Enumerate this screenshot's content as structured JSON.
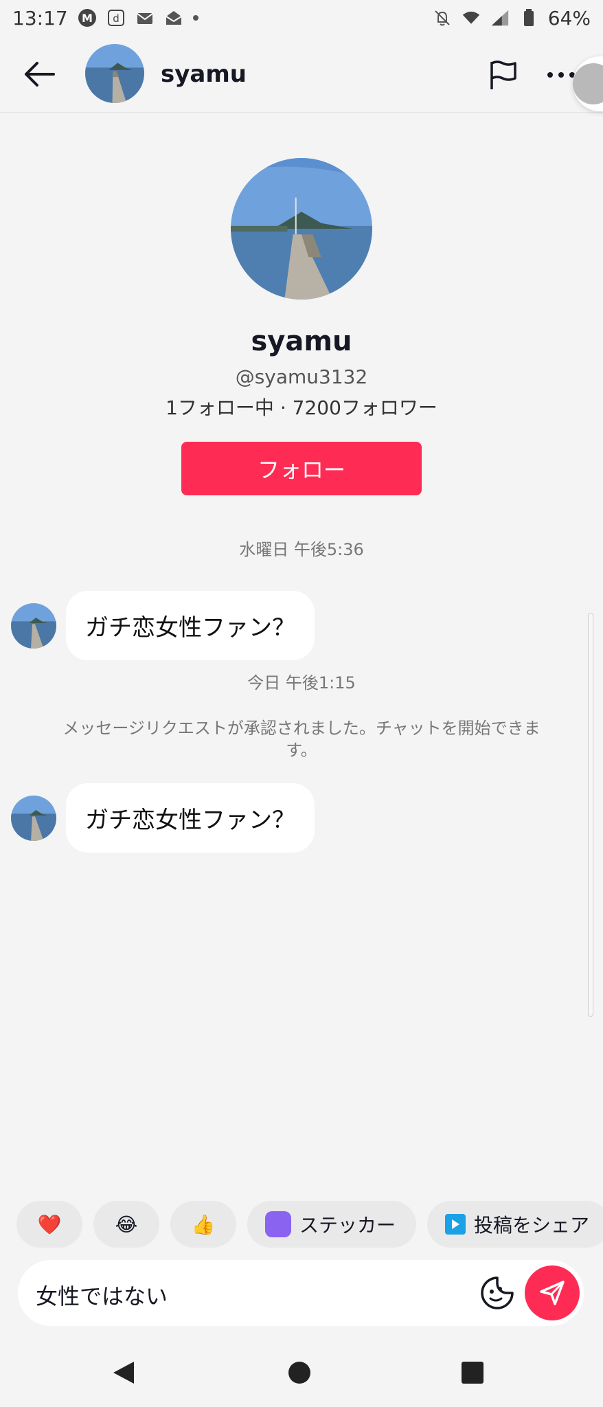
{
  "status_bar": {
    "time": "13:17",
    "battery": "64%"
  },
  "header": {
    "name": "syamu"
  },
  "profile": {
    "name": "syamu",
    "handle": "@syamu3132",
    "stats": "1フォロー中 · 7200フォロワー",
    "follow_label": "フォロー"
  },
  "chat": {
    "timestamp_1": "水曜日 午後5:36",
    "message_1": "ガチ恋女性ファン？",
    "timestamp_2": "今日 午後1:15",
    "system_notice": "メッセージリクエストが承認されました。チャットを開始できます。",
    "message_2": "ガチ恋女性ファン？"
  },
  "quick_replies": {
    "heart": "❤️",
    "laugh": "😂",
    "thumbs": "👍",
    "sticker_label": "ステッカー",
    "share_label": "投稿をシェア"
  },
  "composer": {
    "text": "女性ではない"
  },
  "colors": {
    "accent": "#fe2c55",
    "background": "#f4f4f4",
    "bubble": "#ffffff"
  }
}
